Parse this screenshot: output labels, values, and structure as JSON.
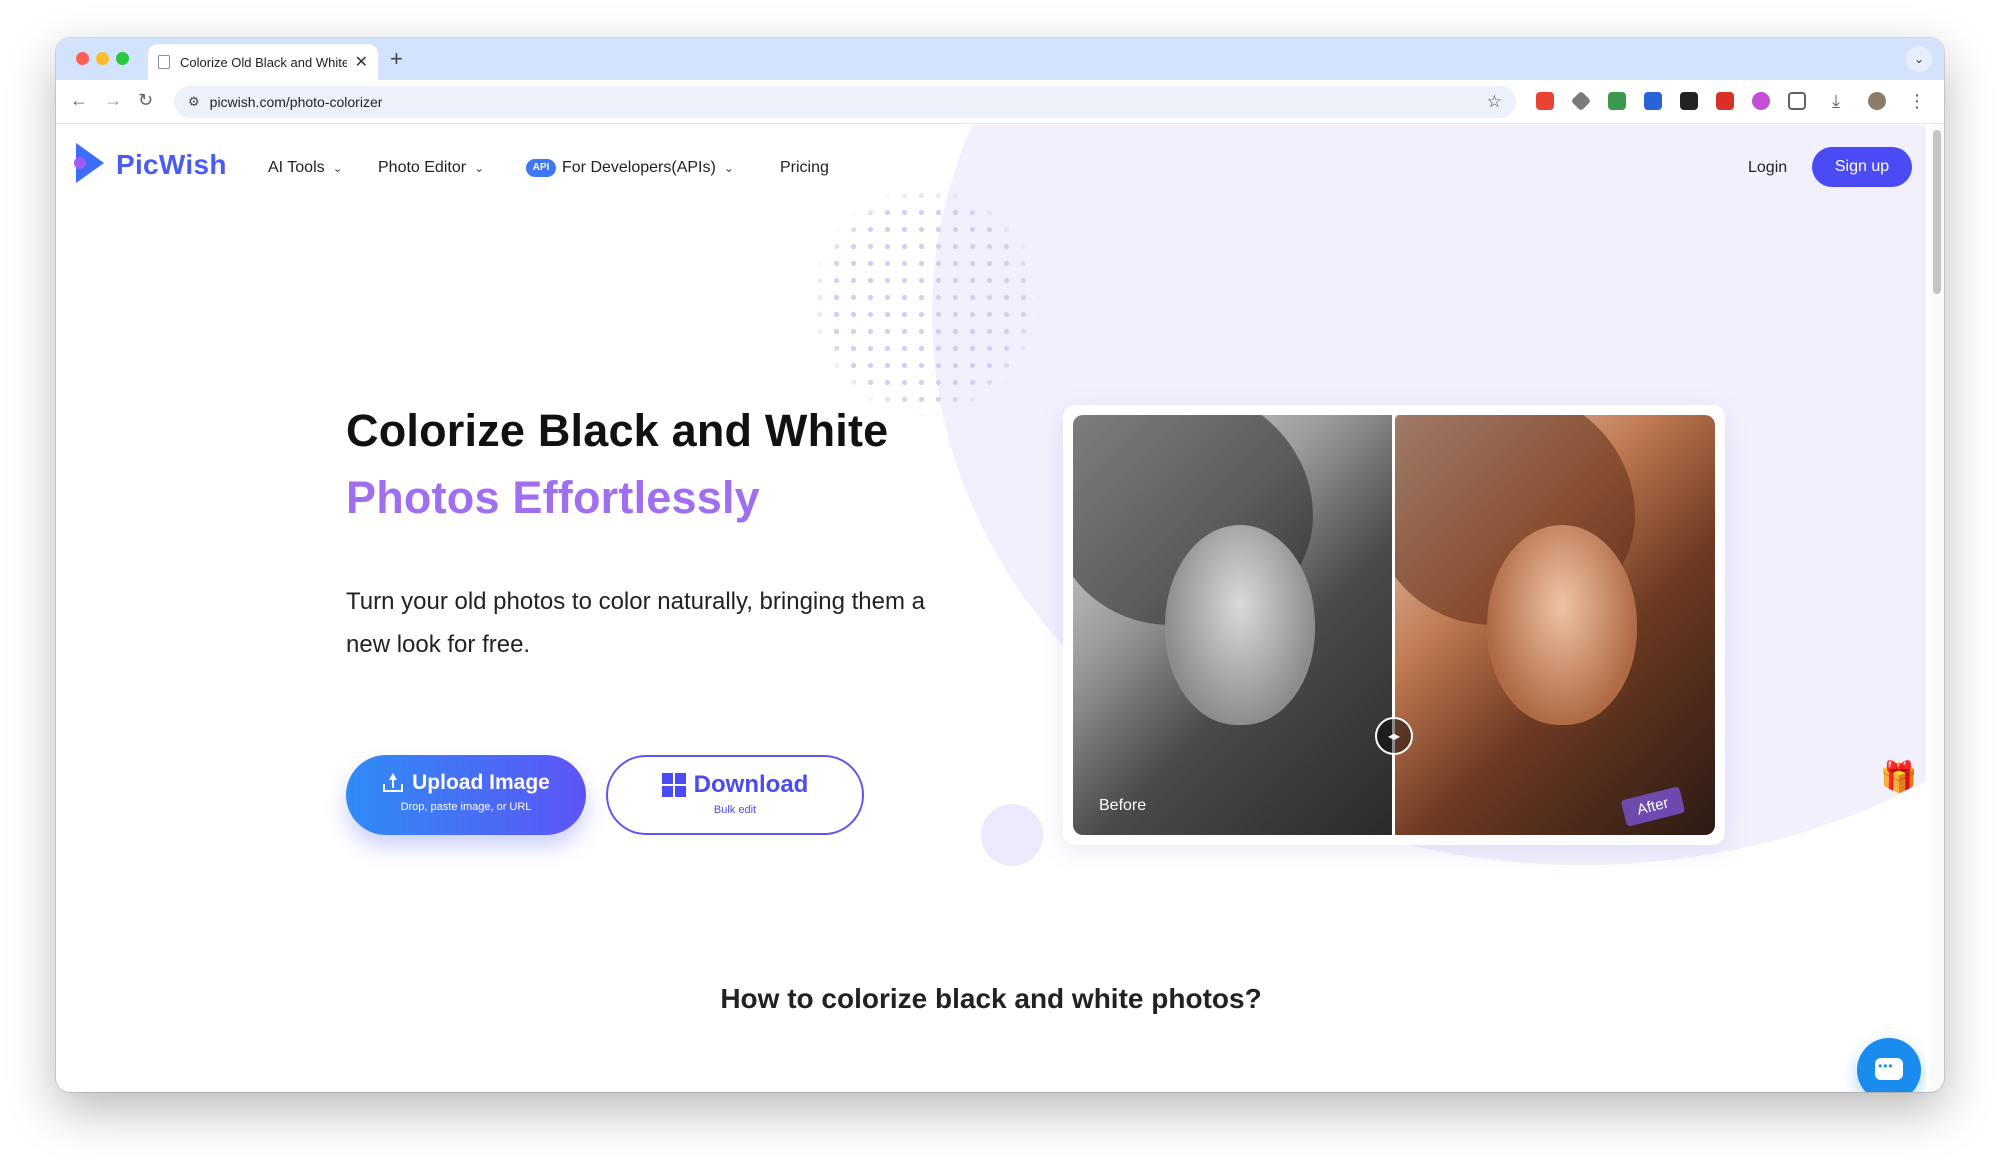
{
  "browser": {
    "tab_title": "Colorize Old Black and White",
    "tab_close": "✕",
    "new_tab": "+",
    "tab_menu": "⌄",
    "url": "picwish.com/photo-colorizer",
    "icons": [
      "back-icon",
      "forward-icon",
      "reload-icon",
      "site-settings-icon",
      "bookmark-star-icon",
      "downloads-icon",
      "profile-icon",
      "menu-icon"
    ]
  },
  "header": {
    "brand": "PicWish",
    "brand_color": "#4b5bf5",
    "menu": [
      {
        "label": "AI Tools"
      },
      {
        "label": "Photo Editor"
      },
      {
        "label": "For Developers(APIs)",
        "badge": "API"
      },
      {
        "label": "Pricing"
      }
    ],
    "login": "Login",
    "signup": "Sign up"
  },
  "hero": {
    "title_line1": "Colorize Black and White",
    "title_line2": "Photos Effortlessly",
    "accent_color": "#a06ef0",
    "description": "Turn your old photos to color naturally, bringing them a new look for free.",
    "upload_button": {
      "label": "Upload Image",
      "sub": "Drop, paste image, or URL"
    },
    "download_button": {
      "label": "Download",
      "sub": "Bulk edit"
    }
  },
  "comparison": {
    "before_label": "Before",
    "after_label": "After",
    "handle": "◂▸"
  },
  "section": {
    "how_title": "How to colorize black and white photos?"
  }
}
